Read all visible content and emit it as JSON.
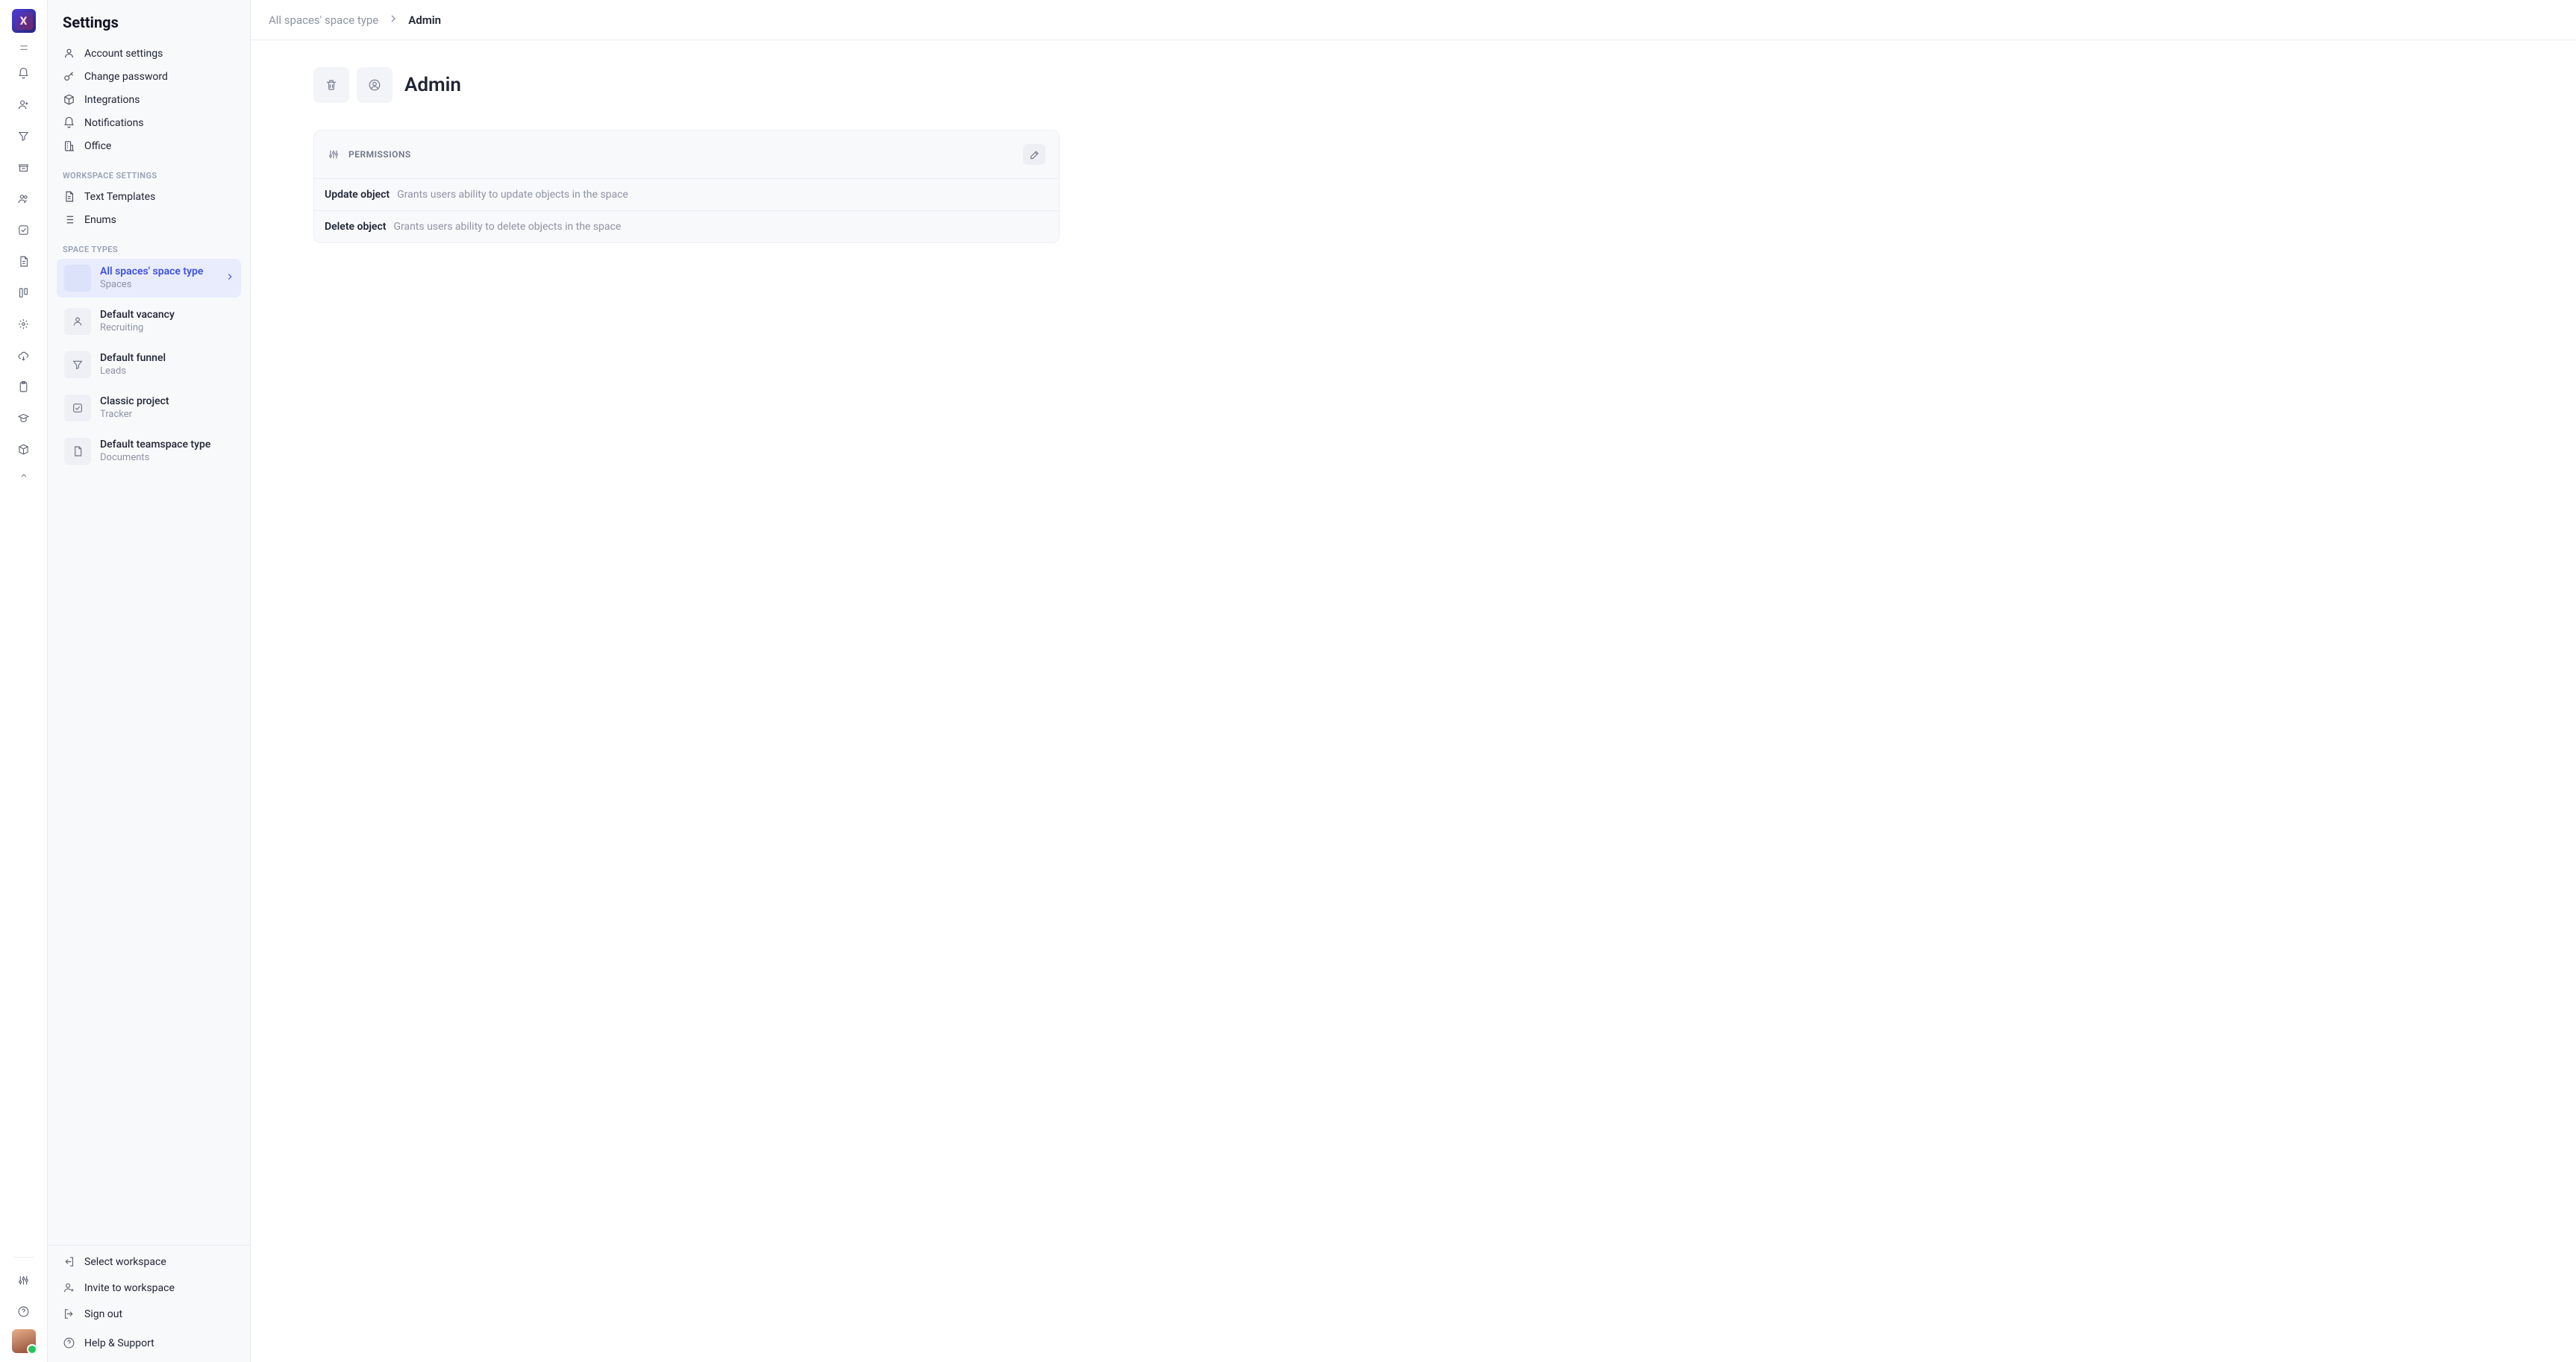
{
  "rail": {
    "logo_letter": "X"
  },
  "sidebar": {
    "title": "Settings",
    "items_top": [
      {
        "label": "Account settings"
      },
      {
        "label": "Change password"
      },
      {
        "label": "Integrations"
      },
      {
        "label": "Notifications"
      },
      {
        "label": "Office"
      }
    ],
    "section_workspace": "WORKSPACE SETTINGS",
    "items_workspace": [
      {
        "label": "Text Templates"
      },
      {
        "label": "Enums"
      }
    ],
    "section_space_types": "SPACE TYPES",
    "space_types": [
      {
        "title": "All spaces' space type",
        "sub": "Spaces",
        "active": true
      },
      {
        "title": "Default vacancy",
        "sub": "Recruiting"
      },
      {
        "title": "Default funnel",
        "sub": "Leads"
      },
      {
        "title": "Classic project",
        "sub": "Tracker"
      },
      {
        "title": "Default teamspace type",
        "sub": "Documents"
      }
    ],
    "footer": [
      {
        "label": "Select workspace"
      },
      {
        "label": "Invite to workspace"
      },
      {
        "label": "Sign out"
      },
      {
        "label": "Help & Support"
      }
    ]
  },
  "breadcrumbs": {
    "parent": "All spaces' space type",
    "current": "Admin"
  },
  "page": {
    "title": "Admin",
    "panel_title": "PERMISSIONS",
    "permissions": [
      {
        "name": "Update object",
        "desc": "Grants users ability to update objects in the space"
      },
      {
        "name": "Delete object",
        "desc": "Grants users ability to delete objects in the space"
      }
    ]
  }
}
